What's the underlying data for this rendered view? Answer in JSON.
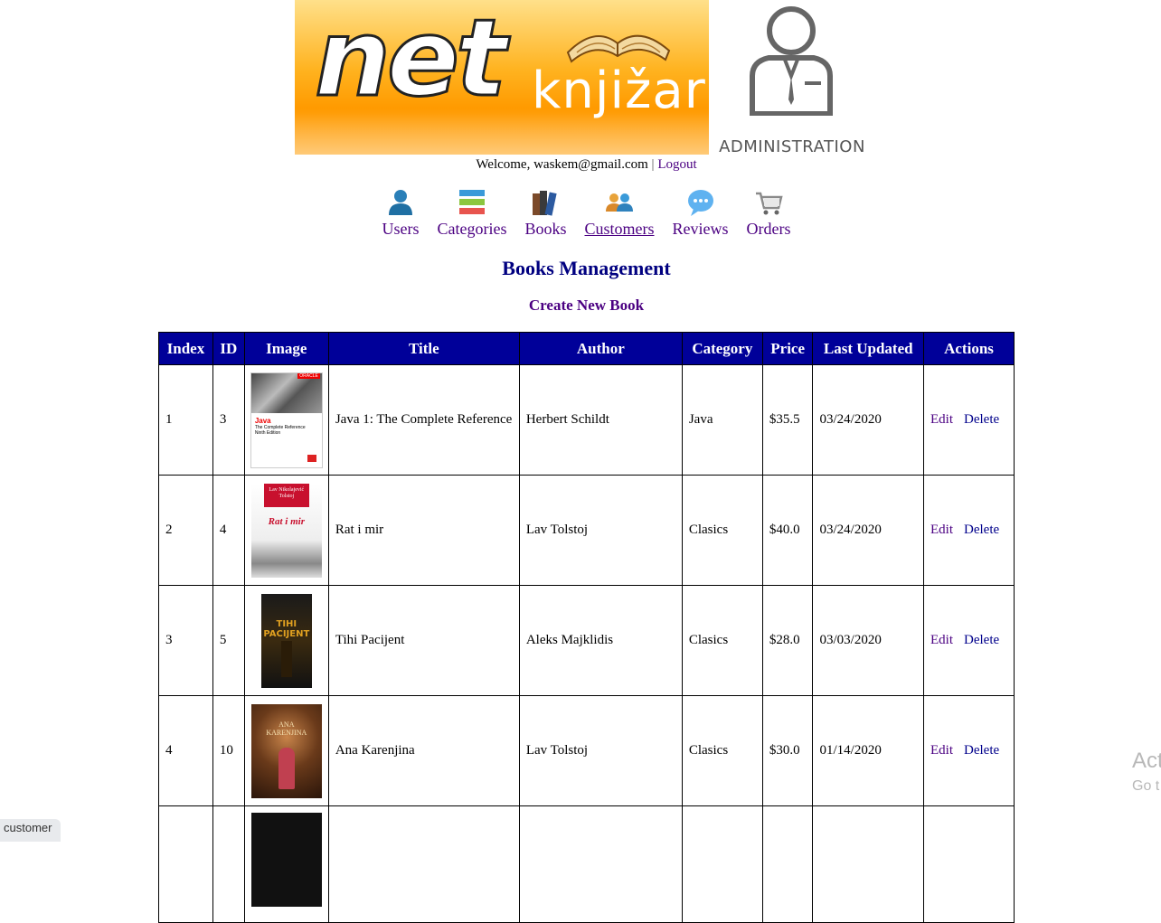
{
  "header": {
    "logo_word": "net",
    "logo_sub": "knjižara",
    "admin_label": "ADMINISTRATION",
    "welcome_prefix": "Welcome, waskem@gmail.com",
    "separator": "|",
    "logout": "Logout"
  },
  "nav": [
    {
      "label": "Users",
      "icon": "users-icon"
    },
    {
      "label": "Categories",
      "icon": "categories-icon"
    },
    {
      "label": "Books",
      "icon": "books-icon"
    },
    {
      "label": "Customers",
      "icon": "customers-icon",
      "active": true
    },
    {
      "label": "Reviews",
      "icon": "reviews-icon"
    },
    {
      "label": "Orders",
      "icon": "orders-icon"
    }
  ],
  "page": {
    "title": "Books Management",
    "create_link": "Create New Book"
  },
  "table": {
    "headers": [
      "Index",
      "ID",
      "Image",
      "Title",
      "Author",
      "Category",
      "Price",
      "Last Updated",
      "Actions"
    ],
    "rows": [
      {
        "index": "1",
        "id": "3",
        "title": "Java 1: The Complete Reference",
        "author": "Herbert Schildt",
        "category": "Java",
        "price": "$35.5",
        "updated": "03/24/2020"
      },
      {
        "index": "2",
        "id": "4",
        "title": "Rat i mir",
        "author": "Lav Tolstoj",
        "category": "Clasics",
        "price": "$40.0",
        "updated": "03/24/2020"
      },
      {
        "index": "3",
        "id": "5",
        "title": "Tihi Pacijent",
        "author": "Aleks Majklidis",
        "category": "Clasics",
        "price": "$28.0",
        "updated": "03/03/2020"
      },
      {
        "index": "4",
        "id": "10",
        "title": "Ana Karenjina",
        "author": "Lav Tolstoj",
        "category": "Clasics",
        "price": "$30.0",
        "updated": "01/14/2020"
      }
    ],
    "edit_label": "Edit",
    "delete_label": "Delete"
  },
  "covers": {
    "java": {
      "brand": "ORACLE",
      "title": "Java",
      "subtitle": "The Complete Reference",
      "edition": "Ninth Edition"
    },
    "rat": {
      "author": "Lav Nikolajević Tolstoj",
      "title": "Rat i mir"
    },
    "tihi": {
      "title": "TIHI PACIJENT"
    },
    "ana": {
      "title": "ANA KARENJINA"
    }
  },
  "taskbar_chip": "customer",
  "watermark": {
    "line1": "Act",
    "line2": "Go t"
  },
  "colors": {
    "header_bg": "#000099",
    "nav_text": "#4b0082",
    "title": "#000080",
    "banner_orange": "#ff9a00"
  }
}
